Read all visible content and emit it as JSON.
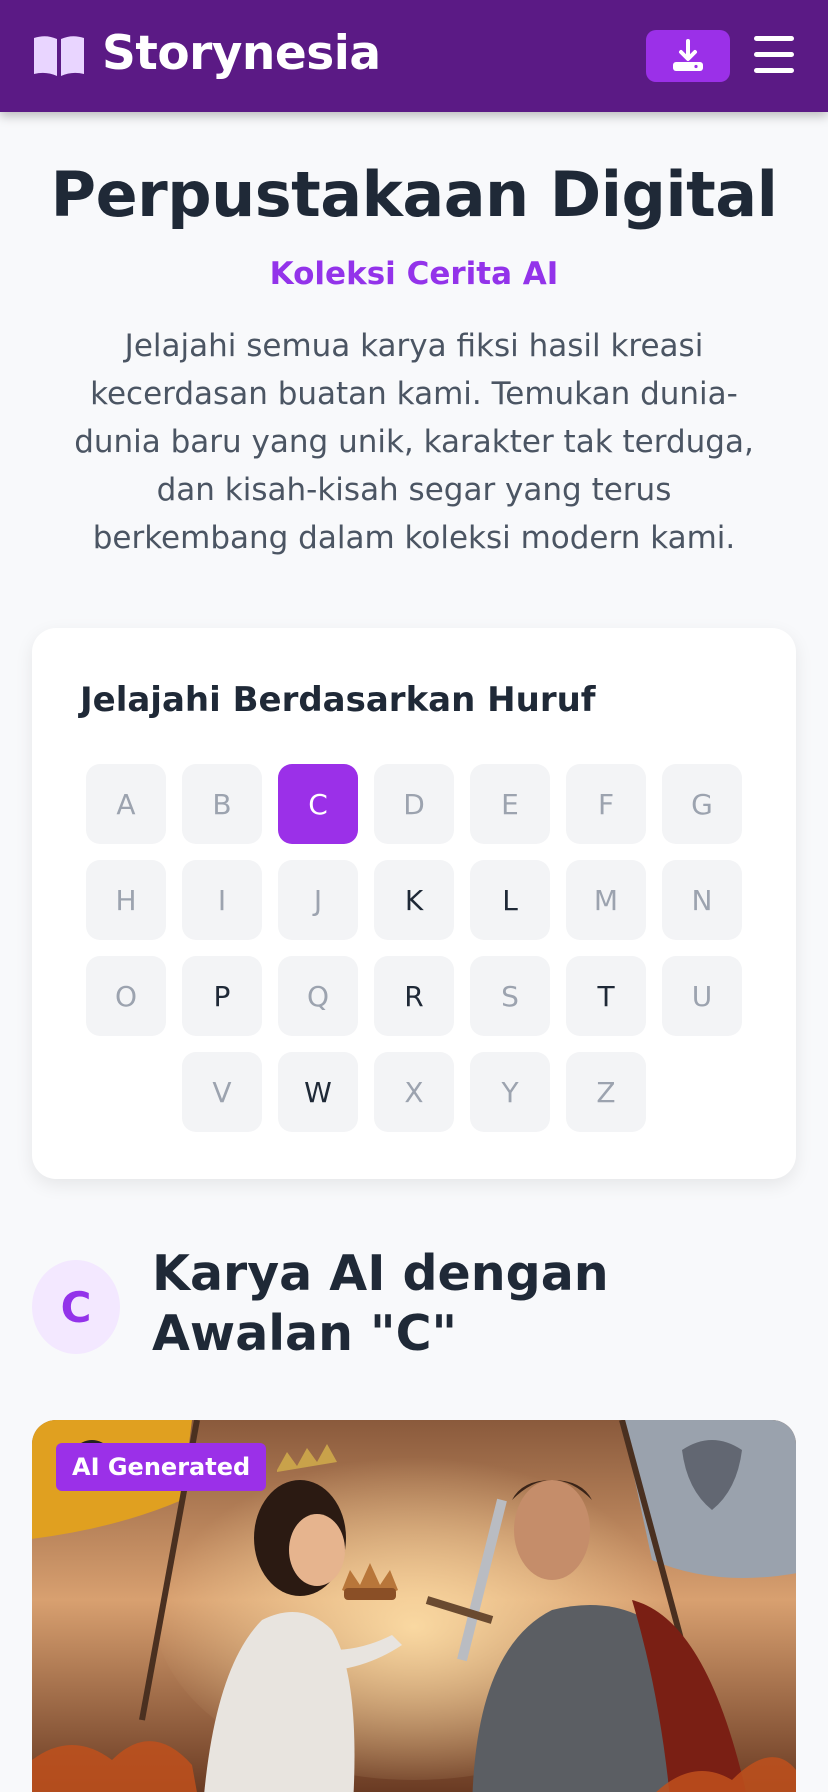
{
  "header": {
    "brand": "Storynesia",
    "logo_icon": "open-book-icon",
    "download_icon": "download-icon",
    "menu_icon": "hamburger-menu-icon",
    "bg_color": "#5b1a85",
    "accent_color": "#9b30e8"
  },
  "hero": {
    "title": "Perpustakaan Digital",
    "subtitle": "Koleksi Cerita AI",
    "description": "Jelajahi semua karya fiksi hasil kreasi kecerdasan buatan kami. Temukan dunia-dunia baru yang unik, karakter tak terduga, dan kisah-kisah segar yang terus berkembang dalam koleksi modern kami."
  },
  "alphabet": {
    "title": "Jelajahi Berdasarkan Huruf",
    "active": "C",
    "letters": [
      {
        "letter": "A",
        "available": false
      },
      {
        "letter": "B",
        "available": false
      },
      {
        "letter": "C",
        "available": true
      },
      {
        "letter": "D",
        "available": false
      },
      {
        "letter": "E",
        "available": false
      },
      {
        "letter": "F",
        "available": false
      },
      {
        "letter": "G",
        "available": false
      },
      {
        "letter": "H",
        "available": false
      },
      {
        "letter": "I",
        "available": false
      },
      {
        "letter": "J",
        "available": false
      },
      {
        "letter": "K",
        "available": true
      },
      {
        "letter": "L",
        "available": true
      },
      {
        "letter": "M",
        "available": false
      },
      {
        "letter": "N",
        "available": false
      },
      {
        "letter": "O",
        "available": false
      },
      {
        "letter": "P",
        "available": true
      },
      {
        "letter": "Q",
        "available": false
      },
      {
        "letter": "R",
        "available": true
      },
      {
        "letter": "S",
        "available": false
      },
      {
        "letter": "T",
        "available": true
      },
      {
        "letter": "U",
        "available": false
      },
      {
        "letter": "V",
        "available": false
      },
      {
        "letter": "W",
        "available": true
      },
      {
        "letter": "X",
        "available": false
      },
      {
        "letter": "Y",
        "available": false
      },
      {
        "letter": "Z",
        "available": false
      }
    ]
  },
  "section": {
    "badge_letter": "C",
    "title": "Karya AI dengan Awalan \"C\""
  },
  "story": {
    "badge": "AI Generated"
  }
}
